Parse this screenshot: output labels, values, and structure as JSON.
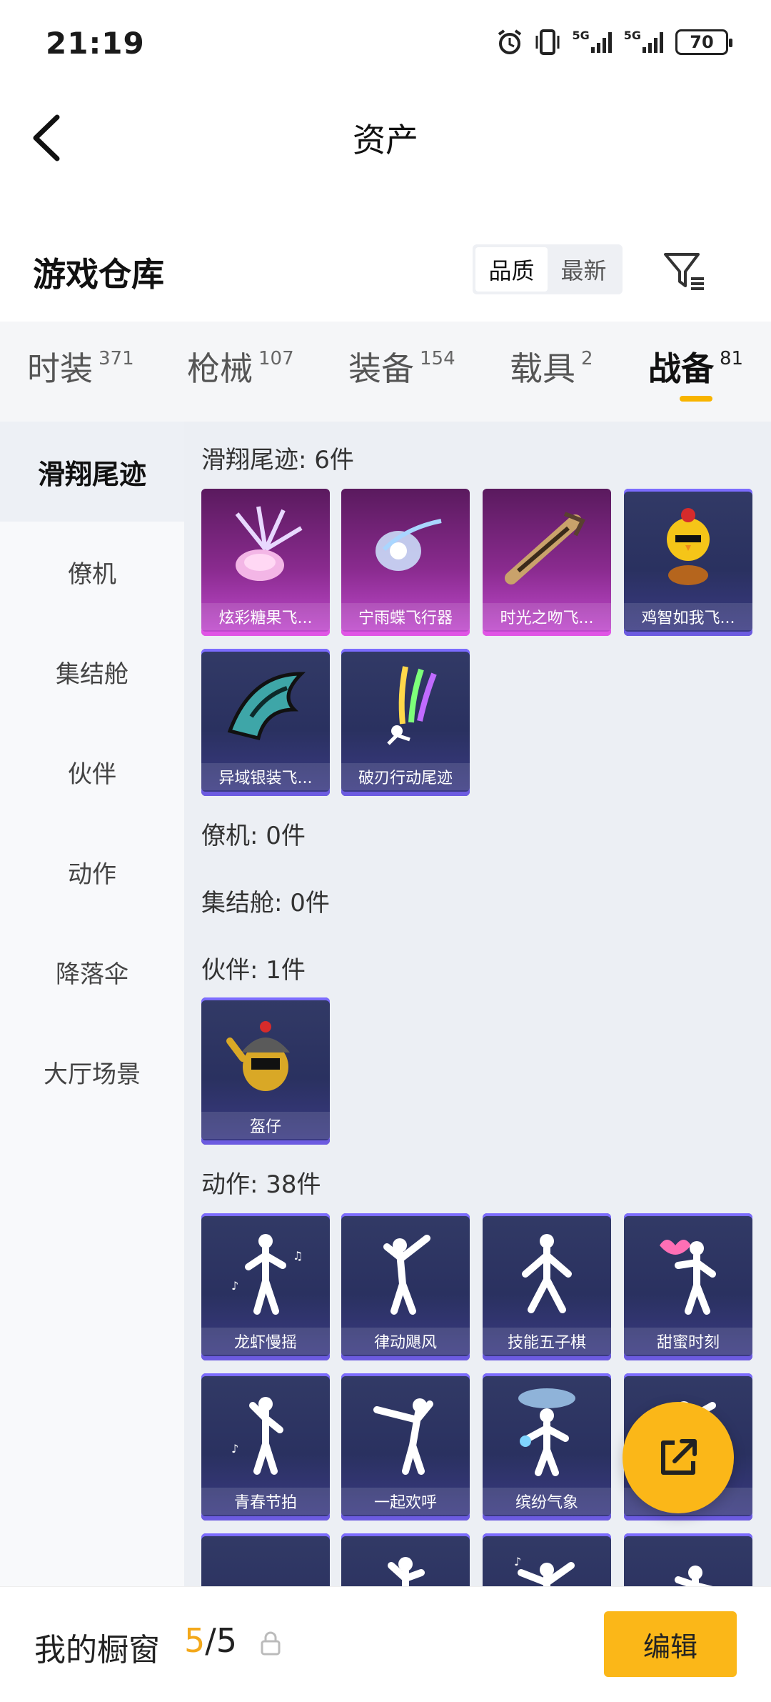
{
  "status_bar": {
    "time": "21:19",
    "network_1": "5G",
    "network_2": "5G",
    "battery": "70"
  },
  "nav": {
    "title": "资产"
  },
  "warehouse": {
    "title": "游戏仓库",
    "sort_options": [
      "品质",
      "最新"
    ],
    "sort_selected": "品质"
  },
  "tabs": [
    {
      "label": "时装",
      "count": "371"
    },
    {
      "label": "枪械",
      "count": "107"
    },
    {
      "label": "装备",
      "count": "154"
    },
    {
      "label": "载具",
      "count": "2"
    },
    {
      "label": "战备",
      "count": "81",
      "active": true
    }
  ],
  "sidebar": {
    "items": [
      "滑翔尾迹",
      "僚机",
      "集结舱",
      "伙伴",
      "动作",
      "降落伞",
      "大厅场景"
    ],
    "selected": "滑翔尾迹"
  },
  "sections": {
    "glide": {
      "title": "滑翔尾迹: 6件",
      "items": [
        "炫彩糖果飞...",
        "宁雨蝶飞行器",
        "时光之吻飞...",
        "鸡智如我飞...",
        "异域银装飞...",
        "破刃行动尾迹"
      ]
    },
    "wingman": {
      "title": "僚机: 0件"
    },
    "pod": {
      "title": "集结舱: 0件"
    },
    "partner": {
      "title": "伙伴: 1件",
      "items": [
        "盔仔"
      ]
    },
    "emote": {
      "title": "动作: 38件",
      "items": [
        "龙虾慢摇",
        "律动飓风",
        "技能五子棋",
        "甜蜜时刻",
        "青春节拍",
        "一起欢呼",
        "缤纷气象",
        ""
      ]
    }
  },
  "bottom_bar": {
    "label": "我的橱窗",
    "current": "5",
    "total": "/5",
    "edit_label": "编辑"
  },
  "colors": {
    "accent": "#fbb718",
    "rare_purple": "#c24bd0",
    "card_blue": "#2a3160"
  }
}
